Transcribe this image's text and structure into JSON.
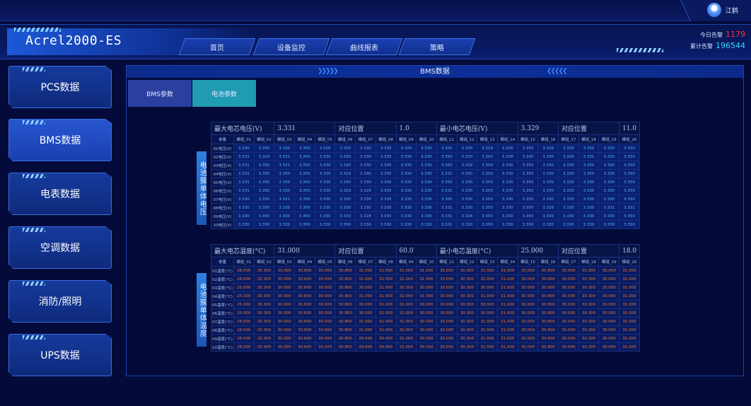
{
  "user": {
    "name": "江鹤"
  },
  "app": {
    "title": "Acrel2000-ES"
  },
  "nav": [
    "首页",
    "设备监控",
    "曲线报表",
    "策略"
  ],
  "alarms": {
    "today_label": "今日告警",
    "today_value": "1179",
    "total_label": "累计告警",
    "total_value": "196544",
    "today_color": "#ff3030",
    "total_color": "#30d8ff"
  },
  "sidebar": [
    "PCS数据",
    "BMS数据",
    "电表数据",
    "空调数据",
    "消防/照明",
    "UPS数据"
  ],
  "panel": {
    "title": "BMS数据",
    "tabs": [
      "BMS参数",
      "电池参数"
    ]
  },
  "voltage": {
    "side_label": "电池簇单体电压",
    "info": [
      "最大电芯电压(V)",
      "3.331",
      "对应位置",
      "1.0",
      "最小电芯电压(V)",
      "3.329",
      "对应位置",
      "11.0"
    ],
    "corner": "参量",
    "columns": [
      "模组_01",
      "模组_02",
      "模组_03",
      "模组_04",
      "模组_05",
      "模组_06",
      "模组_07",
      "模组_08",
      "模组_09",
      "模组_10",
      "模组_11",
      "模组_12",
      "模组_13",
      "模组_14",
      "模组_15",
      "模组_16",
      "模组_17",
      "模组_18",
      "模组_19",
      "模组_20"
    ],
    "rows": [
      {
        "label": "01电压(V)",
        "values": [
          "3.330",
          "3.350",
          "3.330",
          "3.350",
          "3.326",
          "3.350",
          "3.330",
          "3.330",
          "3.329",
          "3.330",
          "3.350",
          "3.330",
          "3.329",
          "3.326",
          "3.350",
          "3.326",
          "3.330",
          "3.350",
          "3.330",
          "3.350"
        ]
      },
      {
        "label": "02电压(V)",
        "values": [
          "3.331",
          "3.329",
          "3.331",
          "3.350",
          "3.330",
          "3.330",
          "3.330",
          "3.330",
          "3.330",
          "3.330",
          "3.350",
          "3.330",
          "3.350",
          "3.328",
          "3.330",
          "3.330",
          "3.330",
          "3.331",
          "3.330",
          "3.350"
        ]
      },
      {
        "label": "03电压(V)",
        "values": [
          "3.331",
          "3.350",
          "3.331",
          "3.350",
          "3.330",
          "3.330",
          "3.330",
          "3.330",
          "3.330",
          "3.330",
          "3.350",
          "3.329",
          "3.350",
          "3.330",
          "3.350",
          "3.330",
          "3.330",
          "3.350",
          "3.330",
          "3.350"
        ]
      },
      {
        "label": "04电压(V)",
        "values": [
          "3.331",
          "3.350",
          "3.330",
          "3.350",
          "3.330",
          "3.329",
          "3.330",
          "3.330",
          "3.330",
          "3.330",
          "3.331",
          "3.330",
          "3.350",
          "3.330",
          "3.350",
          "3.330",
          "3.330",
          "3.350",
          "3.330",
          "3.350"
        ]
      },
      {
        "label": "05电压(V)",
        "values": [
          "3.331",
          "3.350",
          "3.330",
          "3.350",
          "3.330",
          "3.330",
          "3.330",
          "3.330",
          "3.330",
          "3.330",
          "3.350",
          "3.330",
          "3.350",
          "3.330",
          "3.350",
          "3.330",
          "3.330",
          "3.330",
          "3.330",
          "3.350"
        ]
      },
      {
        "label": "06电压(V)",
        "values": [
          "3.331",
          "3.350",
          "3.330",
          "3.350",
          "3.330",
          "3.329",
          "3.329",
          "3.330",
          "3.330",
          "3.330",
          "3.331",
          "3.330",
          "3.350",
          "3.330",
          "3.350",
          "3.330",
          "3.330",
          "3.330",
          "3.330",
          "3.350"
        ]
      },
      {
        "label": "07电压(V)",
        "values": [
          "3.330",
          "3.350",
          "3.331",
          "3.350",
          "3.330",
          "3.330",
          "3.330",
          "3.330",
          "3.330",
          "3.330",
          "3.350",
          "3.330",
          "3.350",
          "3.330",
          "3.350",
          "3.330",
          "3.330",
          "3.330",
          "3.330",
          "3.350"
        ]
      },
      {
        "label": "08电压(V)",
        "values": [
          "3.330",
          "3.350",
          "3.330",
          "3.350",
          "3.330",
          "3.330",
          "3.330",
          "3.330",
          "3.330",
          "3.330",
          "3.331",
          "3.330",
          "3.350",
          "3.330",
          "3.350",
          "3.328",
          "3.330",
          "3.330",
          "3.331",
          "3.331"
        ]
      },
      {
        "label": "09电压(V)",
        "values": [
          "3.330",
          "3.350",
          "3.330",
          "3.350",
          "3.330",
          "3.330",
          "3.328",
          "3.330",
          "3.330",
          "3.330",
          "3.331",
          "3.328",
          "3.350",
          "3.330",
          "3.350",
          "3.330",
          "3.330",
          "3.330",
          "3.330",
          "3.350"
        ]
      },
      {
        "label": "10电压(V)",
        "values": [
          "3.330",
          "3.350",
          "3.330",
          "3.350",
          "3.330",
          "3.350",
          "3.330",
          "3.330",
          "3.330",
          "3.330",
          "3.331",
          "3.330",
          "3.350",
          "3.330",
          "3.350",
          "3.330",
          "3.330",
          "3.330",
          "3.330",
          "3.350"
        ]
      }
    ]
  },
  "temperature": {
    "side_label": "电池簇单体温度",
    "info": [
      "最大电芯温度(°C)",
      "31.000",
      "对应位置",
      "60.0",
      "最小电芯温度(°C)",
      "25.000",
      "对应位置",
      "18.0"
    ],
    "corner": "参量",
    "columns": [
      "模组_01",
      "模组_02",
      "模组_03",
      "模组_04",
      "模组_05",
      "模组_06",
      "模组_07",
      "模组_08",
      "模组_09",
      "模组_10",
      "模组_11",
      "模组_12",
      "模组_13",
      "模组_14",
      "模组_15",
      "模组_16",
      "模组_17",
      "模组_18",
      "模组_19",
      "模组_20"
    ],
    "rows": [
      {
        "label": "01温度(°C)",
        "values": [
          "28.000",
          "30.300",
          "30.000",
          "30.800",
          "30.000",
          "30.800",
          "31.000",
          "31.000",
          "31.000",
          "31.000",
          "30.000",
          "30.300",
          "31.000",
          "31.000",
          "30.000",
          "30.800",
          "30.000",
          "30.300",
          "30.000",
          "31.000"
        ]
      },
      {
        "label": "02温度(°C)",
        "values": [
          "28.000",
          "30.300",
          "30.000",
          "30.800",
          "30.000",
          "30.800",
          "31.000",
          "31.000",
          "31.000",
          "31.000",
          "30.000",
          "30.300",
          "31.000",
          "31.000",
          "30.000",
          "30.800",
          "30.000",
          "30.300",
          "30.000",
          "31.000"
        ]
      },
      {
        "label": "03温度(°C)",
        "values": [
          "25.000",
          "30.300",
          "30.000",
          "30.800",
          "30.000",
          "30.800",
          "30.000",
          "31.000",
          "30.300",
          "30.000",
          "30.000",
          "30.300",
          "30.000",
          "31.000",
          "30.000",
          "30.800",
          "30.000",
          "30.300",
          "30.000",
          "31.000"
        ]
      },
      {
        "label": "04温度(°C)",
        "values": [
          "25.000",
          "30.300",
          "30.000",
          "30.800",
          "30.000",
          "30.800",
          "31.000",
          "31.000",
          "31.000",
          "31.000",
          "30.000",
          "30.300",
          "31.000",
          "31.000",
          "30.000",
          "30.800",
          "30.000",
          "30.300",
          "30.000",
          "31.000"
        ]
      },
      {
        "label": "05温度(°C)",
        "values": [
          "25.000",
          "30.300",
          "30.000",
          "30.800",
          "30.000",
          "30.800",
          "30.000",
          "31.000",
          "31.000",
          "30.000",
          "30.000",
          "30.300",
          "30.000",
          "31.000",
          "30.000",
          "30.800",
          "30.000",
          "30.300",
          "30.000",
          "31.000"
        ]
      },
      {
        "label": "06温度(°C)",
        "values": [
          "25.000",
          "30.300",
          "30.000",
          "30.800",
          "30.000",
          "30.800",
          "30.000",
          "31.000",
          "31.000",
          "30.000",
          "30.000",
          "30.300",
          "30.000",
          "31.000",
          "30.000",
          "30.800",
          "30.000",
          "30.300",
          "30.000",
          "31.000"
        ]
      },
      {
        "label": "07温度(°C)",
        "values": [
          "28.000",
          "30.300",
          "30.000",
          "30.800",
          "30.000",
          "30.800",
          "31.000",
          "31.000",
          "31.000",
          "30.000",
          "30.000",
          "30.300",
          "31.000",
          "31.000",
          "30.000",
          "30.800",
          "30.000",
          "30.300",
          "30.000",
          "31.000"
        ]
      },
      {
        "label": "08温度(°C)",
        "values": [
          "28.000",
          "30.300",
          "30.000",
          "30.800",
          "30.000",
          "30.800",
          "31.000",
          "31.000",
          "30.300",
          "30.000",
          "30.000",
          "30.300",
          "31.000",
          "31.000",
          "30.000",
          "30.800",
          "30.000",
          "30.300",
          "30.000",
          "31.000"
        ]
      },
      {
        "label": "09温度(°C)",
        "values": [
          "28.000",
          "25.000",
          "30.000",
          "30.800",
          "30.000",
          "30.800",
          "29.000",
          "30.000",
          "31.000",
          "30.000",
          "30.000",
          "30.300",
          "31.000",
          "31.000",
          "30.000",
          "30.800",
          "30.000",
          "30.300",
          "30.000",
          "31.000"
        ]
      },
      {
        "label": "10温度(°C)",
        "values": [
          "28.000",
          "25.000",
          "30.000",
          "30.800",
          "30.000",
          "30.800",
          "29.000",
          "30.000",
          "31.000",
          "30.000",
          "30.000",
          "30.300",
          "31.000",
          "31.000",
          "30.000",
          "30.800",
          "30.000",
          "30.300",
          "30.000",
          "31.000"
        ]
      }
    ]
  }
}
